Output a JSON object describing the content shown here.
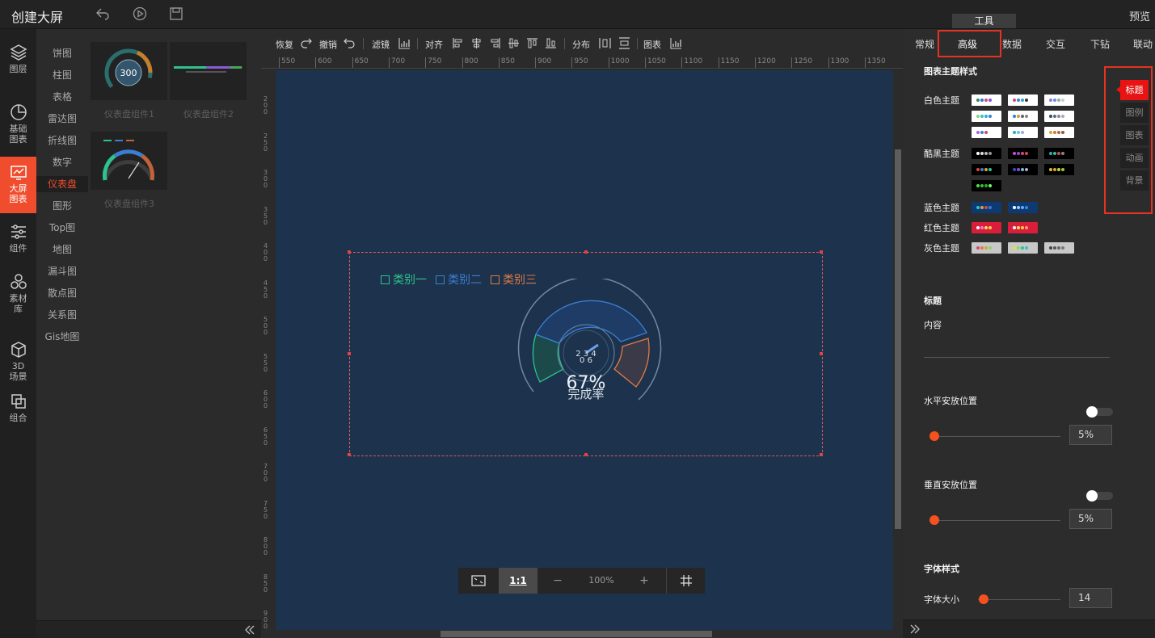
{
  "app": {
    "title": "创建大屏",
    "preview": "预览",
    "tools_tab": "工具"
  },
  "leftnav": [
    {
      "label1": "图层",
      "label2": "",
      "label3": ""
    },
    {
      "label1": "基础",
      "label2": "图表",
      "label3": ""
    },
    {
      "label1": "大屏",
      "label2": "图表",
      "label3": ""
    },
    {
      "label1": "组件",
      "label2": "",
      "label3": ""
    },
    {
      "label1": "素材",
      "label2": "库",
      "label3": ""
    },
    {
      "label1": "3D",
      "label2": "场景",
      "label3": ""
    },
    {
      "label1": "组合",
      "label2": "",
      "label3": ""
    }
  ],
  "categories": [
    "饼图",
    "柱图",
    "表格",
    "雷达图",
    "折线图",
    "数字",
    "仪表盘",
    "图形",
    "Top图",
    "地图",
    "漏斗图",
    "散点图",
    "关系图",
    "Gis地图"
  ],
  "active_category": "仪表盘",
  "thumbs": [
    {
      "label": "仪表盘组件1",
      "value": "300"
    },
    {
      "label": "仪表盘组件2",
      "value": ""
    },
    {
      "label": "仪表盘组件3",
      "value": ""
    }
  ],
  "toolbar": {
    "redo": "恢复",
    "undo": "撤销",
    "filter": "滤镜",
    "align": "对齐",
    "distribute": "分布",
    "chart": "图表"
  },
  "ruler_top": [
    "550",
    "600",
    "650",
    "700",
    "750",
    "800",
    "850",
    "900",
    "950",
    "1000",
    "1050",
    "1100",
    "1150",
    "1200",
    "1250",
    "1300",
    "1350"
  ],
  "ruler_left": [
    "200",
    "250",
    "300",
    "350",
    "400",
    "450",
    "500",
    "550",
    "600",
    "650",
    "700",
    "750",
    "800",
    "850",
    "900"
  ],
  "gauge": {
    "legend": [
      {
        "name": "类别一",
        "color": "#2fc28e"
      },
      {
        "name": "类别二",
        "color": "#3a7fd4"
      },
      {
        "name": "类别三",
        "color": "#e07b46"
      }
    ],
    "percent": "67%",
    "caption": "完成率"
  },
  "zoom": {
    "ratio_label": "1:1",
    "level": "100%",
    "minus": "−",
    "plus": "+"
  },
  "rightpanel": {
    "tabs": [
      "常规",
      "高级",
      "数据",
      "交互",
      "下钻",
      "联动"
    ],
    "active_tab": "高级",
    "theme_title": "图表主题样式",
    "themes": [
      "白色主题",
      "酷黑主题",
      "蓝色主题",
      "红色主题",
      "灰色主题"
    ],
    "side_tabs": [
      "标题",
      "图例",
      "图表",
      "动画",
      "背景"
    ],
    "active_side_tab": "标题",
    "title_section": "标题",
    "content_label": "内容",
    "hpos_label": "水平安放位置",
    "hpos_value": "5%",
    "vpos_label": "垂直安放位置",
    "vpos_value": "5%",
    "font_style": "字体样式",
    "font_size_label": "字体大小",
    "font_size_value": "14"
  }
}
